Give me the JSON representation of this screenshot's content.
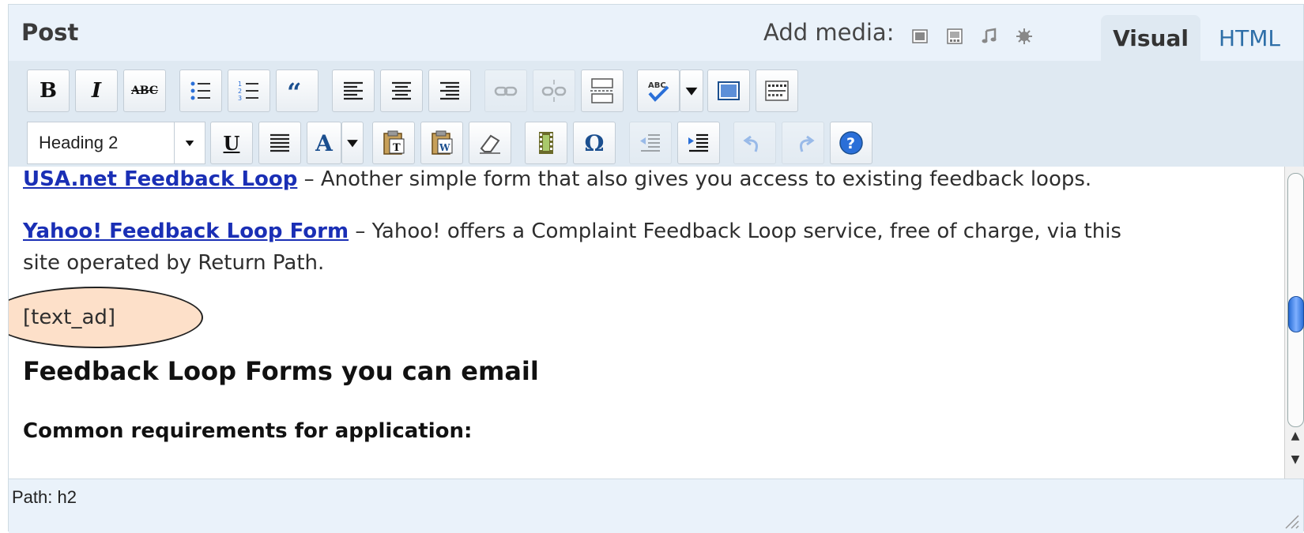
{
  "header": {
    "title": "Post",
    "add_media_label": "Add media:",
    "media_icons": [
      "image-icon",
      "gallery-icon",
      "audio-icon",
      "other-media-icon"
    ],
    "tabs": [
      {
        "label": "Visual",
        "active": true
      },
      {
        "label": "HTML",
        "active": false
      }
    ]
  },
  "toolbar": {
    "row1": [
      "bold-icon",
      "italic-icon",
      "strikethrough-icon",
      "bullet-list-icon",
      "numbered-list-icon",
      "blockquote-icon",
      "align-left-icon",
      "align-center-icon",
      "align-right-icon",
      "link-icon",
      "unlink-icon",
      "more-tag-icon",
      "spellcheck-icon",
      "spellcheck-dropdown-icon",
      "fullscreen-icon",
      "kitchen-sink-icon"
    ],
    "row2": [
      "format-select",
      "underline-icon",
      "justify-icon",
      "text-color-icon",
      "paste-text-icon",
      "paste-word-icon",
      "remove-format-icon",
      "media-icon",
      "special-char-icon",
      "outdent-icon",
      "indent-icon",
      "undo-icon",
      "redo-icon",
      "help-icon"
    ],
    "format_select_value": "Heading 2",
    "bold": "B",
    "italic": "I",
    "strike": "ABC",
    "underline": "U",
    "textcolor": "A",
    "special_char": "Ω"
  },
  "content": {
    "p1_link": "USA.net Feedback Loop",
    "p1_text": " – Another simple form that also gives you access to existing feedback loops.",
    "p2_link": "Yahoo! Feedback Loop Form",
    "p2_text": " – Yahoo! offers a Complaint Feedback Loop service, free of charge, via this",
    "p2_text_cont": "site operated by Return Path.",
    "shortcode": "[text_ad]",
    "heading": "Feedback Loop Forms you can email",
    "subheading": "Common requirements for application:"
  },
  "status": {
    "path": "Path: h2"
  },
  "colors": {
    "toolbar_bg": "#dfe9f2",
    "header_bg": "#eaf2fa",
    "link": "#1a2fb5",
    "tab_html": "#2e6fa8",
    "oval_fill": "#fde0c9"
  }
}
